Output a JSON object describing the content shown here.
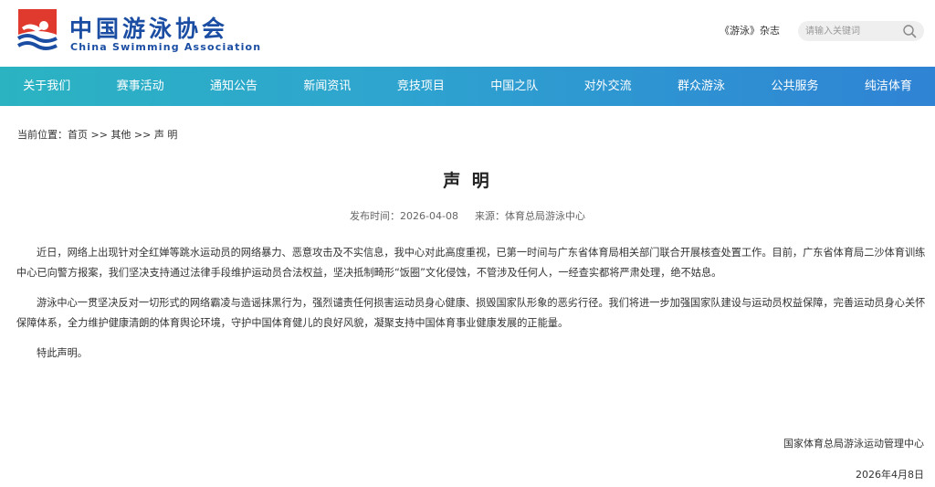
{
  "header": {
    "logo_cn": "中国游泳协会",
    "logo_en": "China Swimming Association",
    "magazine_link": "《游泳》杂志",
    "search_placeholder": "请输入关键词",
    "icons": {
      "logo": "swimmer-logo-icon",
      "search": "search-icon"
    },
    "colors": {
      "brand_blue": "#1b4ea3",
      "brand_red": "#e03a2f"
    }
  },
  "nav": {
    "items": [
      "关于我们",
      "赛事活动",
      "通知公告",
      "新闻资讯",
      "竞技项目",
      "中国之队",
      "对外交流",
      "群众游泳",
      "公共服务",
      "纯洁体育"
    ],
    "gradient": [
      "#2bb3c2",
      "#2f83d4"
    ]
  },
  "breadcrumb": {
    "label": "当前位置：",
    "items": [
      "首页",
      "其他",
      "声 明"
    ],
    "separator": " >> "
  },
  "article": {
    "title": "声 明",
    "publish_label": "发布时间：",
    "publish_date": "2026-04-08",
    "source_label": "来源：",
    "source": "体育总局游泳中心",
    "paragraphs": [
      "近日，网络上出现针对全红婵等跳水运动员的网络暴力、恶意攻击及不实信息，我中心对此高度重视，已第一时间与广东省体育局相关部门联合开展核查处置工作。目前，广东省体育局二沙体育训练中心已向警方报案，我们坚决支持通过法律手段维护运动员合法权益，坚决抵制畸形“饭圈”文化侵蚀，不管涉及任何人，一经查实都将严肃处理，绝不姑息。",
      "游泳中心一贯坚决反对一切形式的网络霸凌与造谣抹黑行为，强烈谴责任何损害运动员身心健康、损毁国家队形象的恶劣行径。我们将进一步加强国家队建设与运动员权益保障，完善运动员身心关怀保障体系，全力维护健康清朗的体育舆论环境，守护中国体育健儿的良好风貌，凝聚支持中国体育事业健康发展的正能量。",
      "特此声明。"
    ],
    "signature_org": "国家体育总局游泳运动管理中心",
    "signature_date": "2026年4月8日"
  }
}
